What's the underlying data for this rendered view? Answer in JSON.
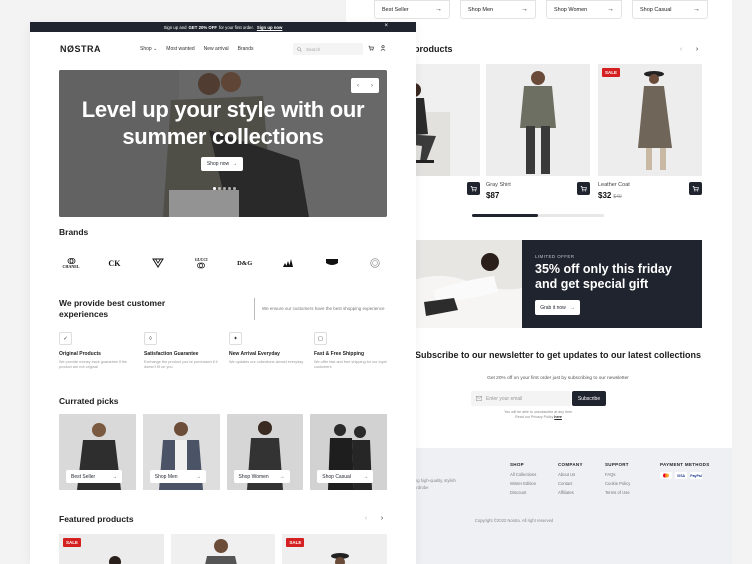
{
  "announcement": {
    "pre": "Sign up and",
    "bold": "GET 20% OFF",
    "post": "for your first order.",
    "link": "Sign up now"
  },
  "brand_logo": "NØSTRA",
  "nav": {
    "shop": "Shop",
    "most_wanted": "Most wanted",
    "new_arrival": "New arrival",
    "brands": "Brands"
  },
  "search": {
    "placeholder": "Search"
  },
  "hero": {
    "title": "Level up your style with our summer collections",
    "button": "Shop now"
  },
  "brands": {
    "title": "Brands",
    "items": [
      "CHANEL",
      "CK",
      "V",
      "GUCCI",
      "D&G",
      "adidas",
      "levi's",
      "Zara"
    ]
  },
  "value_prop": {
    "title": "We provide best customer experiences",
    "text": "We ensure our customers have the best shopping experience"
  },
  "features": [
    {
      "title": "Original Products",
      "text": "We provide money back guarantee if the product are not original"
    },
    {
      "title": "Satisfaction Guarantee",
      "text": "Exchange the product you've purchased if it doesn't fit on you"
    },
    {
      "title": "New Arrival Everyday",
      "text": "We updates our collections almost everyday"
    },
    {
      "title": "Fast & Free Shipping",
      "text": "We offer fast and free shipping for our loyal customers"
    }
  ],
  "picks": {
    "title": "Currated picks",
    "items": [
      "Best Seller",
      "Shop Men",
      "Shop Women",
      "Shop Casual"
    ]
  },
  "featured": {
    "title": "Featured products",
    "sale_label": "SALE"
  },
  "back_pills": [
    "Best Seller",
    "Shop Men",
    "Shop Women",
    "Shop Casual"
  ],
  "back_products_title": "products",
  "products": [
    {
      "name": "",
      "price": ""
    },
    {
      "name": "Gray Shirt",
      "price": "$87",
      "old_price": ""
    },
    {
      "name": "Leather Coat",
      "price": "$32",
      "old_price": "$40",
      "sale": "SALE"
    }
  ],
  "offer": {
    "eyebrow": "LIMITED OFFER",
    "title": "35% off only this friday and get special gift",
    "button": "Grab it now"
  },
  "newsletter": {
    "title": "Subscribe to our newsletter to get updates to our latest collections",
    "subtitle": "Get 20% off on your first order just by subscribing to our newsletter",
    "placeholder": "Enter your email",
    "button": "Subscribe",
    "note_pre": "You will be able to unsubscribe at any time.",
    "note_read": "Read our Privacy Policy",
    "note_link": "here"
  },
  "footer": {
    "tagline_1": "ing high-quality, stylish",
    "tagline_2": "ardrobe",
    "shop": {
      "title": "SHOP",
      "links": [
        "All Collections",
        "Winter Edition",
        "Discount"
      ]
    },
    "company": {
      "title": "COMPANY",
      "links": [
        "About Us",
        "Contact",
        "Affiliates"
      ]
    },
    "support": {
      "title": "SUPPORT",
      "links": [
        "FAQs",
        "Cookie Policy",
        "Terms of Use"
      ]
    },
    "payment": {
      "title": "PAYMENT METHODS",
      "methods": [
        "MC",
        "VISA",
        "PayPal"
      ]
    },
    "copyright": "Copyright ©2022 Nostra. All right reserved"
  },
  "colors": {
    "dark": "#1f242e",
    "sale": "#d42020",
    "footer_bg": "#eef0f3"
  }
}
